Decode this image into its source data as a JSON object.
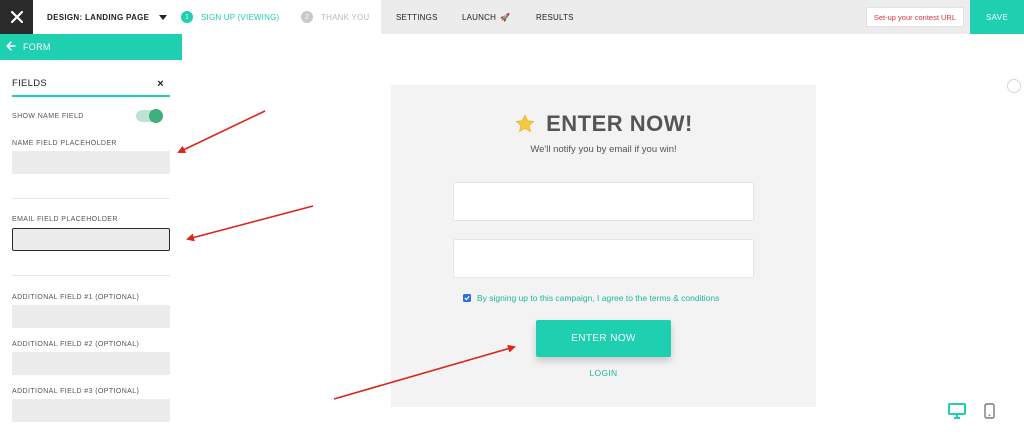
{
  "topbar": {
    "design_label": "DESIGN: LANDING PAGE",
    "steps": [
      {
        "num": "1",
        "label": "SIGN UP (VIEWING)"
      },
      {
        "num": "2",
        "label": "THANK YOU"
      }
    ],
    "nav": {
      "settings": "SETTINGS",
      "launch": "LAUNCH",
      "launch_icon": "🚀",
      "results": "RESULTS"
    },
    "contest_url_label": "Set-up your contest URL",
    "save_label": "SAVE"
  },
  "sidebar": {
    "back_label": "FORM",
    "section_title": "FIELDS",
    "close_glyph": "×",
    "show_name_label": "SHOW NAME FIELD",
    "show_name_enabled": true,
    "name_placeholder_label": "NAME FIELD PLACEHOLDER",
    "name_placeholder_value": "",
    "email_placeholder_label": "EMAIL FIELD PLACEHOLDER",
    "email_placeholder_value": "",
    "additional_fields": [
      {
        "label": "ADDITIONAL FIELD #1 (OPTIONAL)",
        "value": ""
      },
      {
        "label": "ADDITIONAL FIELD #2 (OPTIONAL)",
        "value": ""
      },
      {
        "label": "ADDITIONAL FIELD #3 (OPTIONAL)",
        "value": ""
      }
    ]
  },
  "preview": {
    "title": "ENTER NOW!",
    "subtitle": "We'll notify you by email if you win!",
    "consent_text": "By signing up to this campaign, I agree to the terms & conditions",
    "consent_checked": true,
    "enter_button": "ENTER NOW",
    "login_link": "LOGIN"
  },
  "colors": {
    "accent": "#1ecfb0",
    "dark": "#2b2b2b",
    "alert_red": "#d9363e",
    "annotation_red": "#d9261c"
  },
  "icons": {
    "close": "close-icon",
    "back": "arrow-left-icon",
    "star": "star-icon",
    "desktop": "desktop-icon",
    "mobile": "mobile-icon"
  }
}
